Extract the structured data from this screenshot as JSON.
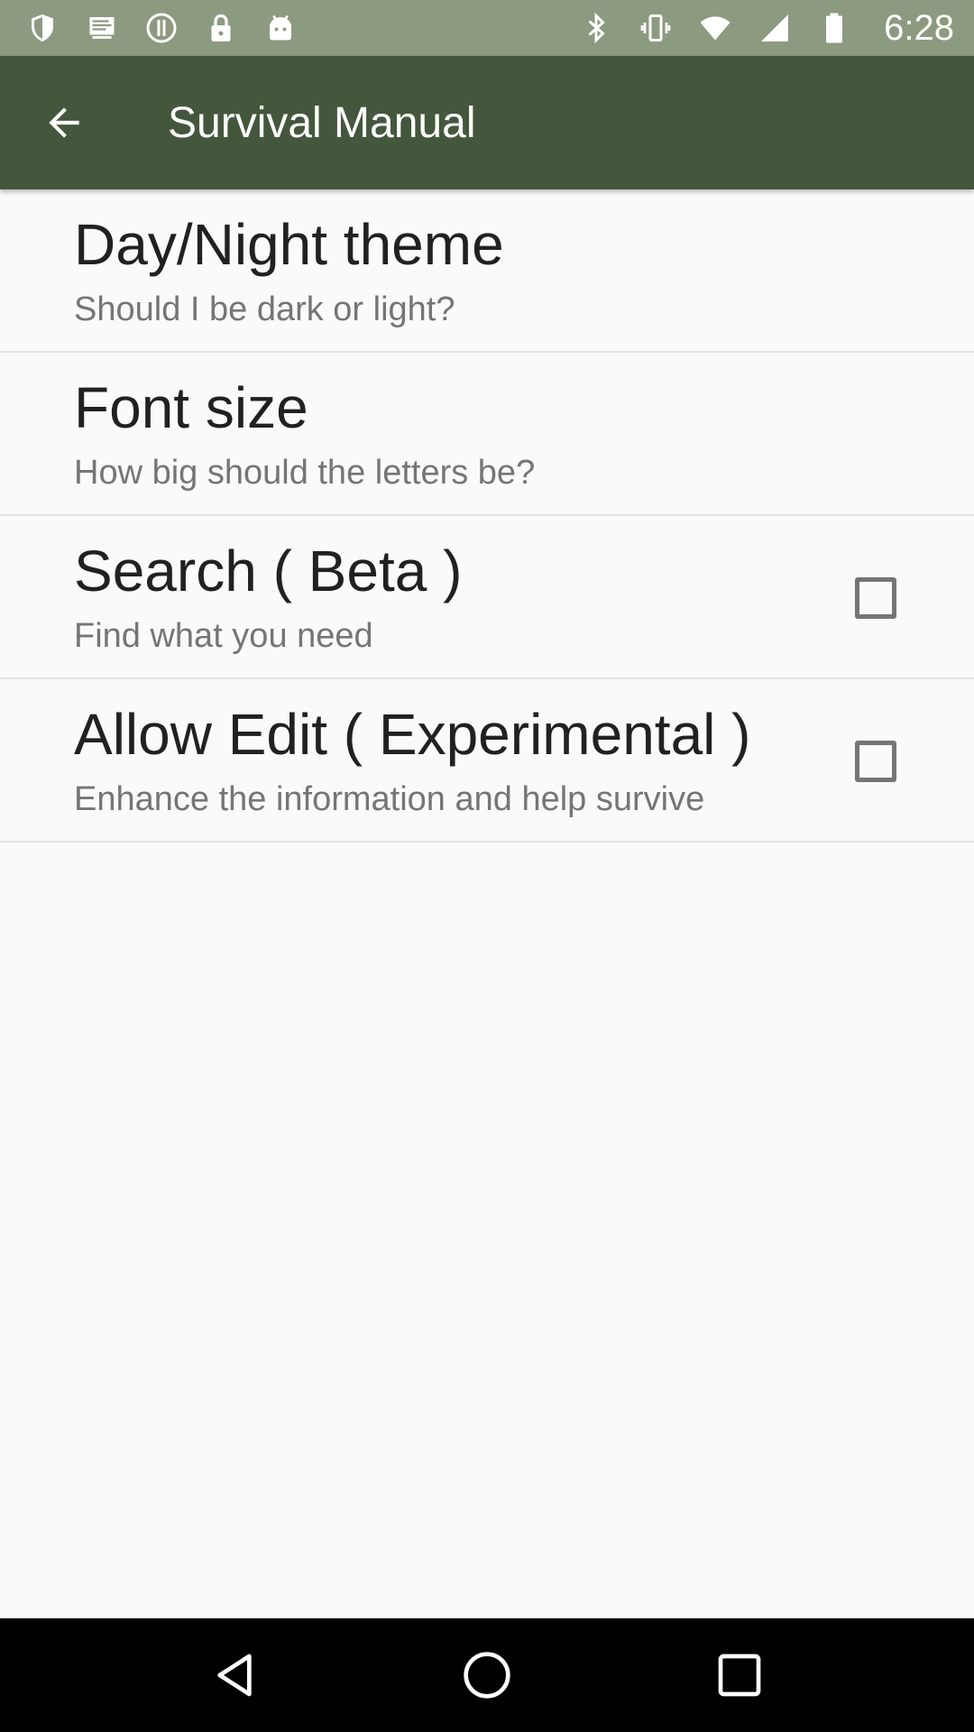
{
  "status_bar": {
    "time": "6:28",
    "left_icons": [
      "shield-icon",
      "notification-icon",
      "info-icon",
      "lock-icon",
      "android-icon"
    ],
    "right_icons": [
      "bluetooth-icon",
      "vibrate-icon",
      "wifi-icon",
      "signal-icon",
      "battery-icon"
    ]
  },
  "app_bar": {
    "title": "Survival Manual",
    "background_color": "#44573d"
  },
  "settings": {
    "items": [
      {
        "title": "Day/Night theme",
        "summary": "Should I be dark or light?",
        "has_checkbox": false
      },
      {
        "title": "Font size",
        "summary": "How big should the letters be?",
        "has_checkbox": false
      },
      {
        "title": "Search ( Beta )",
        "summary": "Find what you need",
        "has_checkbox": true,
        "checked": false
      },
      {
        "title": "Allow Edit ( Experimental )",
        "summary": "Enhance the information and help survive",
        "has_checkbox": true,
        "checked": false
      }
    ]
  },
  "nav_bar": {
    "buttons": [
      "back-triangle-icon",
      "home-circle-icon",
      "recents-square-icon"
    ]
  }
}
